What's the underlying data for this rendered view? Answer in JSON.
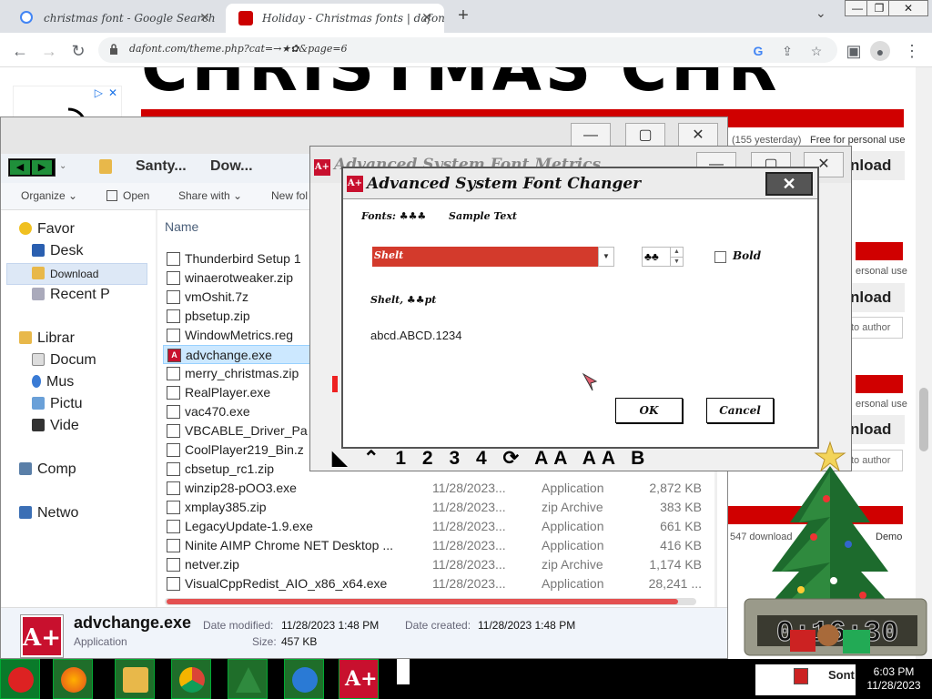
{
  "browser": {
    "tabs": [
      {
        "title": "christmas font - Google Search",
        "active": false
      },
      {
        "title": "Holiday - Christmas fonts | dafont.com",
        "active": true
      }
    ],
    "new_tab": "+",
    "url": "dafont.com/theme.php?cat=→★✿&page=6",
    "window_controls": [
      "—",
      "❐",
      "✕"
    ],
    "tab_dropdown": "⌄"
  },
  "page": {
    "ad_close": "✕",
    "ad_play": "▷",
    "headline": "CHRISTMAS CHR",
    "yesterday": "(155 yesterday)",
    "license1": "Free for personal use",
    "license2": "ersonal use",
    "license3": "ersonal use",
    "download": "nload",
    "to_author": "to author",
    "downloads_meta": "547 download",
    "demo": "Demo"
  },
  "explorer": {
    "breadcrumbs": [
      "Santy...",
      "Dow..."
    ],
    "commands": [
      "Organize",
      "Open",
      "Share with",
      "New fol"
    ],
    "nav": {
      "favorites": "Favor",
      "desktop": "Desk",
      "downloads": "Download",
      "recent": "Recent P",
      "libraries": "Librar",
      "documents": "Docum",
      "music": "Mus",
      "pictures": "Pictu",
      "videos": "Vide",
      "computer": "Comp",
      "network": "Netwo"
    },
    "column_name": "Name",
    "files": [
      {
        "name": "Thunderbird Setup 1",
        "date": "",
        "type": "",
        "size": ""
      },
      {
        "name": "winaerotweaker.zip",
        "date": "",
        "type": "",
        "size": ""
      },
      {
        "name": "vmOshit.7z",
        "date": "",
        "type": "",
        "size": ""
      },
      {
        "name": "pbsetup.zip",
        "date": "",
        "type": "",
        "size": ""
      },
      {
        "name": "WindowMetrics.reg",
        "date": "",
        "type": "",
        "size": ""
      },
      {
        "name": "advchange.exe",
        "date": "",
        "type": "",
        "size": ""
      },
      {
        "name": "merry_christmas.zip",
        "date": "",
        "type": "",
        "size": ""
      },
      {
        "name": "RealPlayer.exe",
        "date": "",
        "type": "",
        "size": ""
      },
      {
        "name": "vac470.exe",
        "date": "",
        "type": "",
        "size": ""
      },
      {
        "name": "VBCABLE_Driver_Pa",
        "date": "",
        "type": "",
        "size": ""
      },
      {
        "name": "CoolPlayer219_Bin.z",
        "date": "",
        "type": "",
        "size": ""
      },
      {
        "name": "cbsetup_rc1.zip",
        "date": "",
        "type": "",
        "size": ""
      },
      {
        "name": "winzip28-pOO3.exe",
        "date": "11/28/2023...",
        "type": "Application",
        "size": "2,872 KB"
      },
      {
        "name": "xmplay385.zip",
        "date": "11/28/2023...",
        "type": "zip Archive",
        "size": "383 KB"
      },
      {
        "name": "LegacyUpdate-1.9.exe",
        "date": "11/28/2023...",
        "type": "Application",
        "size": "661 KB"
      },
      {
        "name": "Ninite AIMP Chrome NET Desktop ...",
        "date": "11/28/2023...",
        "type": "Application",
        "size": "416 KB"
      },
      {
        "name": "netver.zip",
        "date": "11/28/2023...",
        "type": "zip Archive",
        "size": "1,174 KB"
      },
      {
        "name": "VisualCppRedist_AIO_x86_x64.exe",
        "date": "11/28/2023...",
        "type": "Application",
        "size": "28,241 ..."
      }
    ],
    "details": {
      "filename": "advchange.exe",
      "kind": "Application",
      "modified_label": "Date modified:",
      "modified": "11/28/2023 1:48 PM",
      "created_label": "Date created:",
      "created": "11/28/2023 1:48 PM",
      "size_label": "Size:",
      "size": "457 KB"
    }
  },
  "font_changer": {
    "outer_title": "Advanced System Font Metrics",
    "title": "Advanced System Font Changer",
    "fonts_label": "Fonts: ♣♣♣",
    "sample_label": "Sample Text",
    "selected_font": "Shelt",
    "size_value": "♣♣",
    "bold_label": "Bold",
    "sample_header": "Shelt, ♣♣pt",
    "sample_text": "abcd.ABCD.1234",
    "ok": "OK",
    "cancel": "Cancel",
    "close": "✕",
    "toolbar_glyphs": "◣ ⌃ 1 2 3 4 ⟳ AA AA B"
  },
  "tree_widget": {
    "clock_text": "0:16:30"
  },
  "taskbar": {
    "time": "6:03 PM",
    "date": "11/28/2023",
    "tray_label": "Sont"
  }
}
